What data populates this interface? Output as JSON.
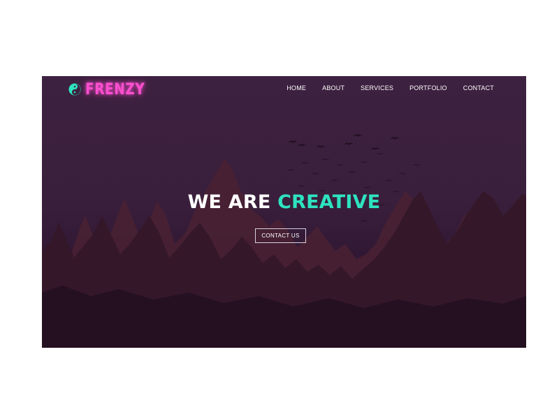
{
  "brand": {
    "name": "FRENZY",
    "logo_icon": "yin-yang-icon",
    "name_color": "#ff4fd0",
    "icon_color": "#2de3c0"
  },
  "nav": {
    "items": [
      {
        "label": "HOME"
      },
      {
        "label": "ABOUT"
      },
      {
        "label": "SERVICES"
      },
      {
        "label": "PORTFOLIO"
      },
      {
        "label": "CONTACT"
      }
    ]
  },
  "hero": {
    "headline_part1": "WE ARE",
    "headline_part2": "CREATIVE",
    "accent_color": "#2de3c0",
    "background_color": "#3d2140",
    "cta_label": "CONTACT US"
  }
}
